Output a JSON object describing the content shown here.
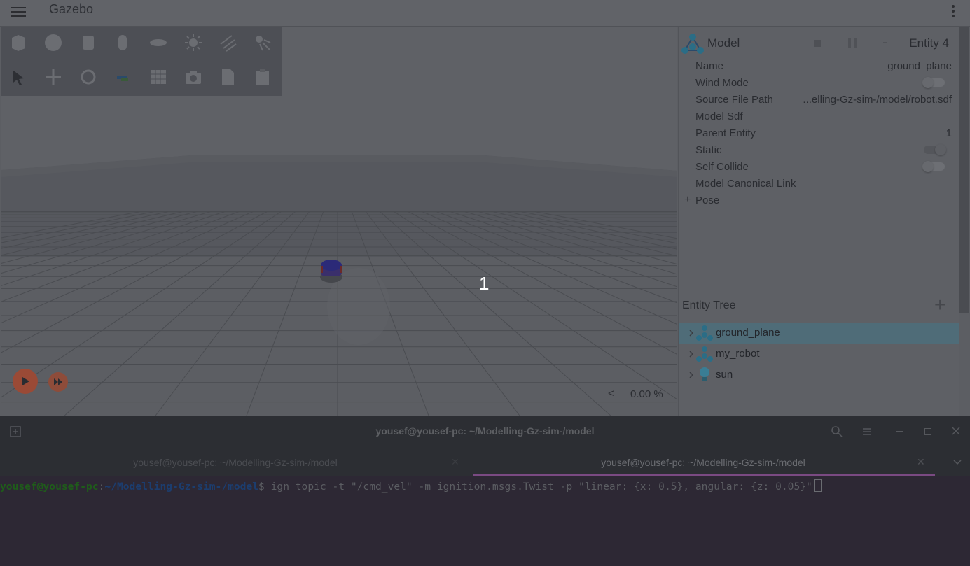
{
  "app": {
    "title": "Gazebo"
  },
  "viewport": {
    "overlay_number": "1",
    "rtf": "0.00 %",
    "rtf_arrow": "<"
  },
  "component_inspector": {
    "title": "Model",
    "entity": "Entity 4",
    "props": {
      "name_label": "Name",
      "name_value": "ground_plane",
      "wind_label": "Wind Mode",
      "source_label": "Source File Path",
      "source_value": "...elling-Gz-sim-/model/robot.sdf",
      "sdf_label": "Model Sdf",
      "parent_label": "Parent Entity",
      "parent_value": "1",
      "static_label": "Static",
      "self_collide_label": "Self Collide",
      "canonical_label": "Model Canonical Link",
      "pose_label": "Pose"
    },
    "toggles": {
      "wind_mode": false,
      "static": true,
      "self_collide": false
    }
  },
  "entity_tree": {
    "title": "Entity Tree",
    "add": "+",
    "items": [
      {
        "label": "ground_plane",
        "icon": "model-icon",
        "selected": true
      },
      {
        "label": "my_robot",
        "icon": "model-icon",
        "selected": false
      },
      {
        "label": "sun",
        "icon": "light-icon",
        "selected": false
      }
    ]
  },
  "terminal": {
    "window_title": "yousef@yousef-pc: ~/Modelling-Gz-sim-/model",
    "tabs": [
      "yousef@yousef-pc: ~/Modelling-Gz-sim-/model",
      "yousef@yousef-pc: ~/Modelling-Gz-sim-/model"
    ],
    "prompt_user": "yousef@yousef-pc",
    "prompt_sep": ":",
    "prompt_path": "~/Modelling-Gz-sim-/model",
    "prompt_end": "$",
    "command": " ign topic -t \"/cmd_vel\" -m ignition.msgs.Twist -p \"linear: {x: 0.5}, angular: {z: 0.05}\""
  },
  "colors": {
    "selection": "#4f6c78",
    "terminal_bg": "#2d2834",
    "prompt_user": "#1f5c1a",
    "prompt_path": "#1c3d6e",
    "play_button": "#9a4a36",
    "active_tab_underline": "#7a4a82"
  }
}
